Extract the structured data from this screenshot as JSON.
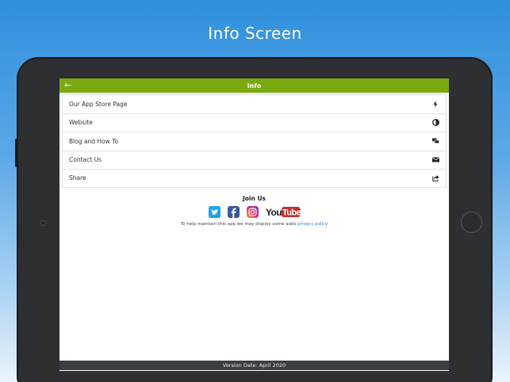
{
  "promo": {
    "title": "Info Screen"
  },
  "header": {
    "title": "Info",
    "back_icon": "back-arrow-icon"
  },
  "menu": {
    "items": [
      {
        "label": "Our App Store Page",
        "icon": "app-store-icon"
      },
      {
        "label": "Website",
        "icon": "globe-icon"
      },
      {
        "label": "Blog and How To",
        "icon": "chat-icon"
      },
      {
        "label": "Contact Us",
        "icon": "mail-icon"
      },
      {
        "label": "Share",
        "icon": "share-icon"
      }
    ]
  },
  "social": {
    "title": "Join Us",
    "icons": [
      "twitter-icon",
      "facebook-icon",
      "instagram-icon",
      "youtube-icon"
    ],
    "youtube_text": "YouTube",
    "note": "To help maintain this app we may display some adds",
    "privacy_link": "privacy policy"
  },
  "footer": {
    "version": "Version Date: April 2020"
  },
  "colors": {
    "header_green": "#7aaa0f",
    "footer_dark": "#3b3e44",
    "twitter": "#1da1f2",
    "facebook": "#3b5998",
    "youtube_red": "#c4302b",
    "link": "#2a7ec2"
  }
}
